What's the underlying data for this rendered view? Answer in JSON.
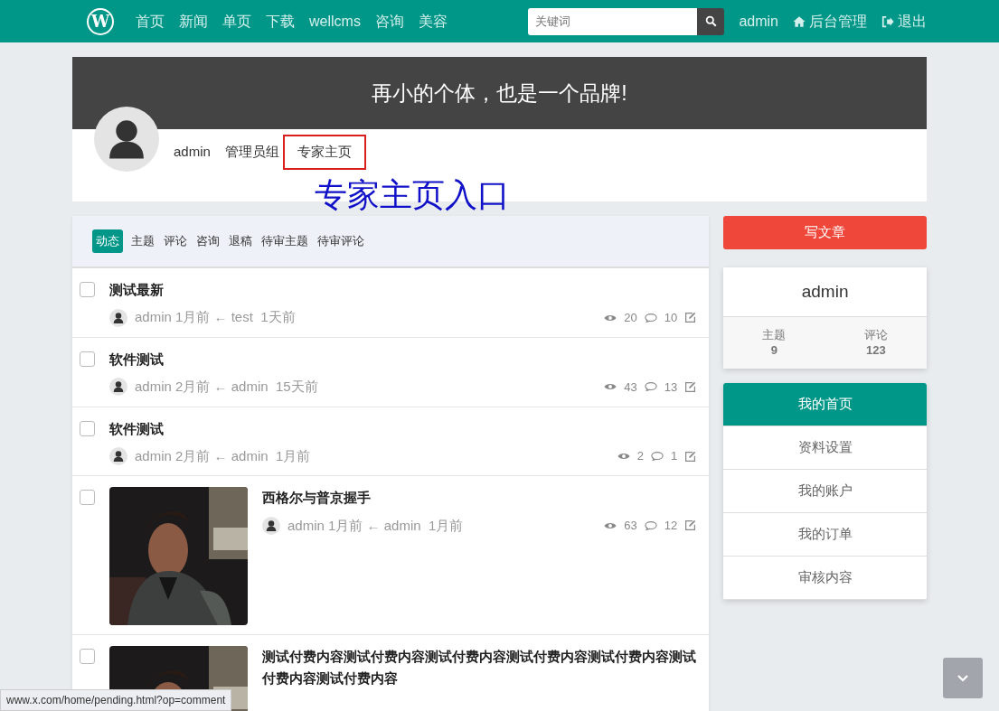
{
  "navbar": {
    "logo": "W",
    "links": [
      "首页",
      "新闻",
      "单页",
      "下载",
      "wellcms",
      "咨询",
      "美容"
    ],
    "search": {
      "placeholder": "关键词"
    },
    "user": "admin",
    "admin_link": "后台管理",
    "logout": "退出"
  },
  "profile": {
    "slogan": "再小的个体，也是一个品牌!",
    "username": "admin",
    "group": "管理员组",
    "expert_link": "专家主页",
    "annotation": "专家主页入口"
  },
  "tabs": [
    {
      "label": "动态",
      "selected": true
    },
    {
      "label": "主题",
      "selected": false
    },
    {
      "label": "评论",
      "selected": false
    },
    {
      "label": "咨询",
      "selected": false
    },
    {
      "label": "退稿",
      "selected": false
    },
    {
      "label": "待审主题",
      "selected": false
    },
    {
      "label": "待审评论",
      "selected": false
    }
  ],
  "threads": [
    {
      "title": "测试最新",
      "checked": false,
      "kind": "text",
      "author": "admin",
      "time": "1月前",
      "arrow": "←",
      "last_user": "test",
      "last_time": "1天前",
      "views": "20",
      "comments": "10"
    },
    {
      "title": "软件测试",
      "checked": false,
      "kind": "text",
      "author": "admin",
      "time": "2月前",
      "arrow": "←",
      "last_user": "admin",
      "last_time": "15天前",
      "views": "43",
      "comments": "13"
    },
    {
      "title": "软件测试",
      "checked": false,
      "kind": "text",
      "author": "admin",
      "time": "2月前",
      "arrow": "←",
      "last_user": "admin",
      "last_time": "1月前",
      "views": "2",
      "comments": "1"
    },
    {
      "title": "西格尔与普京握手",
      "checked": false,
      "author": "admin",
      "time": "1月前",
      "arrow": "←",
      "last_user": "admin",
      "last_time": "1月前",
      "views": "63",
      "comments": "12"
    },
    {
      "title": "测试付费内容测试付费内容测试付费内容测试付费内容测试付费内容测试付费内容测试付费内容",
      "checked": false
    }
  ],
  "sidebar": {
    "write_button": "写文章",
    "user_card": {
      "name": "admin",
      "stats": [
        {
          "label": "主题",
          "value": "9"
        },
        {
          "label": "评论",
          "value": "123"
        }
      ]
    },
    "menu": [
      {
        "label": "我的首页",
        "selected": true
      },
      {
        "label": "资料设置",
        "selected": false
      },
      {
        "label": "我的账户",
        "selected": false
      },
      {
        "label": "我的订单",
        "selected": false
      },
      {
        "label": "审核内容",
        "selected": false
      }
    ]
  },
  "status_url": "www.x.com/home/pending.html?op=comment"
}
